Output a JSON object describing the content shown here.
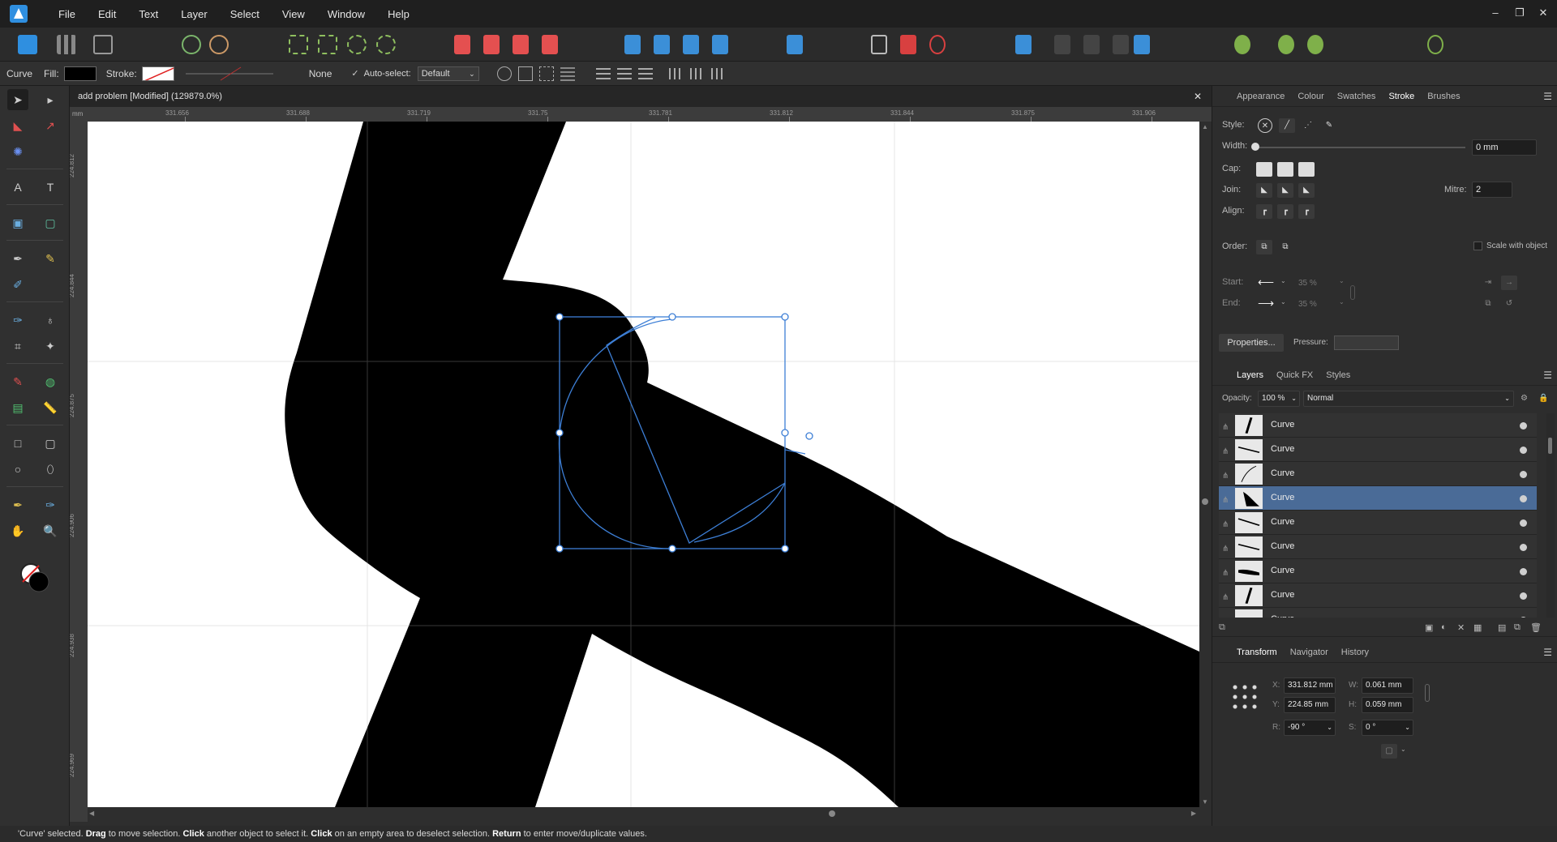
{
  "menubar": {
    "items": [
      "File",
      "Edit",
      "Text",
      "Layer",
      "Select",
      "View",
      "Window",
      "Help"
    ],
    "window_controls": [
      "–",
      "❐",
      "✕"
    ]
  },
  "context_toolbar": {
    "tool_name": "Curve",
    "fill_label": "Fill:",
    "stroke_label": "Stroke:",
    "stroke_style_value": "None",
    "autoselect_label": "Auto-select:",
    "autoselect_value": "Default"
  },
  "document": {
    "tab_title": "add problem [Modified] (129879.0%)",
    "ruler_units": "mm",
    "ruler_h_labels": [
      "331.656",
      "331.688",
      "331.719",
      "331.75",
      "331.781",
      "331.812",
      "331.844",
      "331.875",
      "331.906"
    ],
    "ruler_v_labels": [
      "224.812",
      "224.844",
      "224.875",
      "224.906",
      "224.938",
      "224.969"
    ]
  },
  "stroke_panel": {
    "tabs": [
      "Appearance",
      "Colour",
      "Swatches",
      "Stroke",
      "Brushes"
    ],
    "active_tab": "Stroke",
    "style_label": "Style:",
    "width_label": "Width:",
    "width_value": "0 mm",
    "cap_label": "Cap:",
    "join_label": "Join:",
    "mitre_label": "Mitre:",
    "mitre_value": "2",
    "align_label": "Align:",
    "order_label": "Order:",
    "scale_label": "Scale with object",
    "start_label": "Start:",
    "end_label": "End:",
    "start_pct": "35 %",
    "end_pct": "35 %",
    "properties_button": "Properties...",
    "pressure_label": "Pressure:"
  },
  "layers_panel": {
    "tabs": [
      "Layers",
      "Quick FX",
      "Styles"
    ],
    "active_tab": "Layers",
    "opacity_label": "Opacity:",
    "opacity_value": "100 %",
    "blend_mode": "Normal",
    "layers": [
      {
        "name": "Curve",
        "selected": false
      },
      {
        "name": "Curve",
        "selected": false
      },
      {
        "name": "Curve",
        "selected": false
      },
      {
        "name": "Curve",
        "selected": true
      },
      {
        "name": "Curve",
        "selected": false
      },
      {
        "name": "Curve",
        "selected": false
      },
      {
        "name": "Curve",
        "selected": false
      },
      {
        "name": "Curve",
        "selected": false
      },
      {
        "name": "Curve",
        "selected": false
      }
    ]
  },
  "transform_panel": {
    "tabs": [
      "Transform",
      "Navigator",
      "History"
    ],
    "active_tab": "Transform",
    "x_label": "X:",
    "x_value": "331.812 mm",
    "y_label": "Y:",
    "y_value": "224.85 mm",
    "w_label": "W:",
    "w_value": "0.061 mm",
    "h_label": "H:",
    "h_value": "0.059 mm",
    "r_label": "R:",
    "r_value": "-90 °",
    "s_label": "S:",
    "s_value": "0 °"
  },
  "status_bar": {
    "parts": [
      {
        "t": "'Curve' selected. ",
        "b": false
      },
      {
        "t": "Drag",
        "b": true
      },
      {
        "t": " to move selection. ",
        "b": false
      },
      {
        "t": "Click",
        "b": true
      },
      {
        "t": " another object to select it. ",
        "b": false
      },
      {
        "t": "Click",
        "b": true
      },
      {
        "t": " on an empty area to deselect selection. ",
        "b": false
      },
      {
        "t": "Return",
        "b": true
      },
      {
        "t": " to enter move/duplicate values.",
        "b": false
      }
    ]
  },
  "colors": {
    "accent": "#2f8fe0",
    "selection_blue": "#4a6b97",
    "selection_outline": "#3d7fd6",
    "fill_swatch": "#000000"
  }
}
